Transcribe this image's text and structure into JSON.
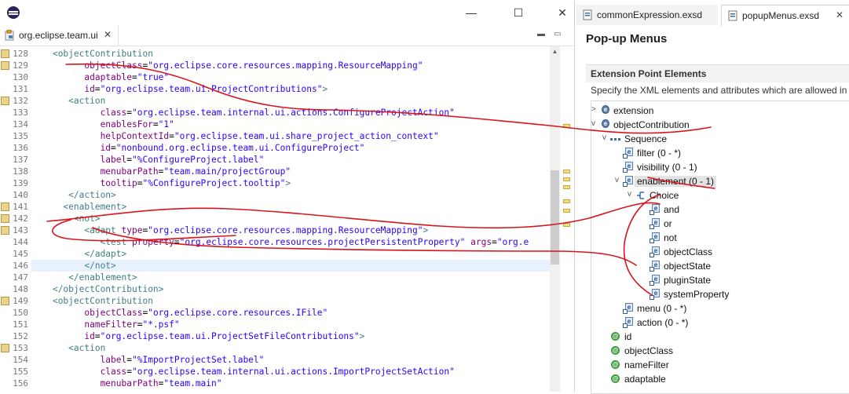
{
  "left_window": {
    "editor_tab": {
      "label": "org.eclipse.team.ui",
      "close": "✕"
    },
    "window_controls": {
      "minimize": "—",
      "maximize": "☐",
      "close": "✕"
    },
    "min_label": "▬",
    "max_label": "▭",
    "lines": [
      {
        "no": "128",
        "indent": "    ",
        "parts": [
          [
            "t-tag",
            "<objectContribution"
          ]
        ],
        "mark": true
      },
      {
        "no": "129",
        "indent": "          ",
        "parts": [
          [
            "t-attr",
            "objectClass"
          ],
          [
            "t-eq",
            "="
          ],
          [
            "t-val",
            "\"org.eclipse.core.resources.mapping.ResourceMapping\""
          ]
        ],
        "mark": true
      },
      {
        "no": "130",
        "indent": "          ",
        "parts": [
          [
            "t-attr",
            "adaptable"
          ],
          [
            "t-eq",
            "="
          ],
          [
            "t-val",
            "\"true\""
          ]
        ]
      },
      {
        "no": "131",
        "indent": "          ",
        "parts": [
          [
            "t-attr",
            "id"
          ],
          [
            "t-eq",
            "="
          ],
          [
            "t-val",
            "\"org.eclipse.team.ui.ProjectContributions\""
          ],
          [
            "t-tag",
            ">"
          ]
        ]
      },
      {
        "no": "132",
        "indent": "       ",
        "parts": [
          [
            "t-tag",
            "<action"
          ]
        ],
        "mark": true
      },
      {
        "no": "133",
        "indent": "             ",
        "parts": [
          [
            "t-attr",
            "class"
          ],
          [
            "t-eq",
            "="
          ],
          [
            "t-val",
            "\"org.eclipse.team.internal.ui.actions.ConfigureProjectAction\""
          ]
        ]
      },
      {
        "no": "134",
        "indent": "             ",
        "parts": [
          [
            "t-attr",
            "enablesFor"
          ],
          [
            "t-eq",
            "="
          ],
          [
            "t-val",
            "\"1\""
          ]
        ]
      },
      {
        "no": "135",
        "indent": "             ",
        "parts": [
          [
            "t-attr",
            "helpContextId"
          ],
          [
            "t-eq",
            "="
          ],
          [
            "t-val",
            "\"org.eclipse.team.ui.share_project_action_context\""
          ]
        ]
      },
      {
        "no": "136",
        "indent": "             ",
        "parts": [
          [
            "t-attr",
            "id"
          ],
          [
            "t-eq",
            "="
          ],
          [
            "t-val",
            "\"nonbound.org.eclipse.team.ui.ConfigureProject\""
          ]
        ]
      },
      {
        "no": "137",
        "indent": "             ",
        "parts": [
          [
            "t-attr",
            "label"
          ],
          [
            "t-eq",
            "="
          ],
          [
            "t-val",
            "\"%ConfigureProject.label\""
          ]
        ]
      },
      {
        "no": "138",
        "indent": "             ",
        "parts": [
          [
            "t-attr",
            "menubarPath"
          ],
          [
            "t-eq",
            "="
          ],
          [
            "t-val",
            "\"team.main/projectGroup\""
          ]
        ]
      },
      {
        "no": "139",
        "indent": "             ",
        "parts": [
          [
            "t-attr",
            "tooltip"
          ],
          [
            "t-eq",
            "="
          ],
          [
            "t-val",
            "\"%ConfigureProject.tooltip\""
          ],
          [
            "t-tag",
            ">"
          ]
        ]
      },
      {
        "no": "140",
        "indent": "       ",
        "parts": [
          [
            "t-tag",
            "</action>"
          ]
        ]
      },
      {
        "no": "141",
        "indent": "      ",
        "parts": [
          [
            "t-tag",
            "<enablement>"
          ]
        ],
        "mark": true
      },
      {
        "no": "142",
        "indent": "        ",
        "parts": [
          [
            "t-tag",
            "<not>"
          ]
        ],
        "mark": true
      },
      {
        "no": "143",
        "indent": "          ",
        "parts": [
          [
            "t-tag",
            "<adapt"
          ],
          [
            "t-txt",
            " "
          ],
          [
            "t-attr",
            "type"
          ],
          [
            "t-eq",
            "="
          ],
          [
            "t-val",
            "\"org.eclipse.core.resources.mapping.ResourceMapping\""
          ],
          [
            "t-tag",
            ">"
          ]
        ],
        "mark": true
      },
      {
        "no": "144",
        "indent": "             ",
        "parts": [
          [
            "t-tag",
            "<test"
          ],
          [
            "t-txt",
            " "
          ],
          [
            "t-attr",
            "property"
          ],
          [
            "t-eq",
            "="
          ],
          [
            "t-val",
            "\"org.eclipse.core.resources.projectPersistentProperty\""
          ],
          [
            "t-txt",
            " "
          ],
          [
            "t-attr",
            "args"
          ],
          [
            "t-eq",
            "="
          ],
          [
            "t-val",
            "\"org.e"
          ]
        ]
      },
      {
        "no": "145",
        "indent": "          ",
        "parts": [
          [
            "t-tag",
            "</adapt>"
          ]
        ]
      },
      {
        "no": "146",
        "indent": "          ",
        "parts": [
          [
            "t-tag",
            "</not>"
          ]
        ],
        "hl": true
      },
      {
        "no": "147",
        "indent": "       ",
        "parts": [
          [
            "t-tag",
            "</enablement>"
          ]
        ]
      },
      {
        "no": "148",
        "indent": "    ",
        "parts": [
          [
            "t-tag",
            "</objectContribution>"
          ]
        ]
      },
      {
        "no": "149",
        "indent": "    ",
        "parts": [
          [
            "t-tag",
            "<objectContribution"
          ]
        ],
        "mark": true
      },
      {
        "no": "150",
        "indent": "          ",
        "parts": [
          [
            "t-attr",
            "objectClass"
          ],
          [
            "t-eq",
            "="
          ],
          [
            "t-val",
            "\"org.eclipse.core.resources.IFile\""
          ]
        ]
      },
      {
        "no": "151",
        "indent": "          ",
        "parts": [
          [
            "t-attr",
            "nameFilter"
          ],
          [
            "t-eq",
            "="
          ],
          [
            "t-val",
            "\"*.psf\""
          ]
        ]
      },
      {
        "no": "152",
        "indent": "          ",
        "parts": [
          [
            "t-attr",
            "id"
          ],
          [
            "t-eq",
            "="
          ],
          [
            "t-val",
            "\"org.eclipse.team.ui.ProjectSetFileContributions\""
          ],
          [
            "t-tag",
            ">"
          ]
        ]
      },
      {
        "no": "153",
        "indent": "       ",
        "parts": [
          [
            "t-tag",
            "<action"
          ]
        ],
        "mark": true
      },
      {
        "no": "154",
        "indent": "             ",
        "parts": [
          [
            "t-attr",
            "label"
          ],
          [
            "t-eq",
            "="
          ],
          [
            "t-val",
            "\"%ImportProjectSet.label\""
          ]
        ]
      },
      {
        "no": "155",
        "indent": "             ",
        "parts": [
          [
            "t-attr",
            "class"
          ],
          [
            "t-eq",
            "="
          ],
          [
            "t-val",
            "\"org.eclipse.team.internal.ui.actions.ImportProjectSetAction\""
          ]
        ]
      },
      {
        "no": "156",
        "indent": "             ",
        "parts": [
          [
            "t-attr",
            "menubarPath"
          ],
          [
            "t-eq",
            "="
          ],
          [
            "t-val",
            "\"team.main\""
          ]
        ]
      }
    ]
  },
  "right_window": {
    "tabs": [
      {
        "label": "commonExpression.exsd",
        "close": "",
        "active": false
      },
      {
        "label": "popupMenus.exsd",
        "close": "✕",
        "active": true
      }
    ],
    "form_title": "Pop-up Menus",
    "section_title": "Extension Point Elements",
    "section_description": "Specify the XML elements and attributes which are allowed in t",
    "tree": [
      {
        "label": "extension",
        "kind": "root",
        "twisty": ">",
        "depth": 0
      },
      {
        "label": "objectContribution",
        "kind": "root",
        "twisty": "v",
        "depth": 0
      },
      {
        "label": "Sequence",
        "kind": "sequence",
        "twisty": "v",
        "depth": 1
      },
      {
        "label": "filter (0 - *)",
        "kind": "element",
        "twisty": "",
        "depth": 2
      },
      {
        "label": "visibility (0 - 1)",
        "kind": "element",
        "twisty": "",
        "depth": 2
      },
      {
        "label": "enablement (0 - 1)",
        "kind": "element",
        "twisty": "v",
        "depth": 2,
        "selected": true
      },
      {
        "label": "Choice",
        "kind": "choice",
        "twisty": "v",
        "depth": 3
      },
      {
        "label": "and",
        "kind": "element",
        "twisty": "",
        "depth": 4
      },
      {
        "label": "or",
        "kind": "element",
        "twisty": "",
        "depth": 4
      },
      {
        "label": "not",
        "kind": "element",
        "twisty": "",
        "depth": 4
      },
      {
        "label": "objectClass",
        "kind": "element",
        "twisty": "",
        "depth": 4
      },
      {
        "label": "objectState",
        "kind": "element",
        "twisty": "",
        "depth": 4
      },
      {
        "label": "pluginState",
        "kind": "element",
        "twisty": "",
        "depth": 4
      },
      {
        "label": "systemProperty",
        "kind": "element",
        "twisty": "",
        "depth": 4
      },
      {
        "label": "menu (0 - *)",
        "kind": "element",
        "twisty": "",
        "depth": 2
      },
      {
        "label": "action (0 - *)",
        "kind": "element",
        "twisty": "",
        "depth": 2
      },
      {
        "label": "id",
        "kind": "attr",
        "twisty": "",
        "depth": 1
      },
      {
        "label": "objectClass",
        "kind": "attr",
        "twisty": "",
        "depth": 1
      },
      {
        "label": "nameFilter",
        "kind": "attr",
        "twisty": "",
        "depth": 1
      },
      {
        "label": "adaptable",
        "kind": "attr",
        "twisty": "",
        "depth": 1
      }
    ]
  },
  "annotation_color": "#d8141c"
}
